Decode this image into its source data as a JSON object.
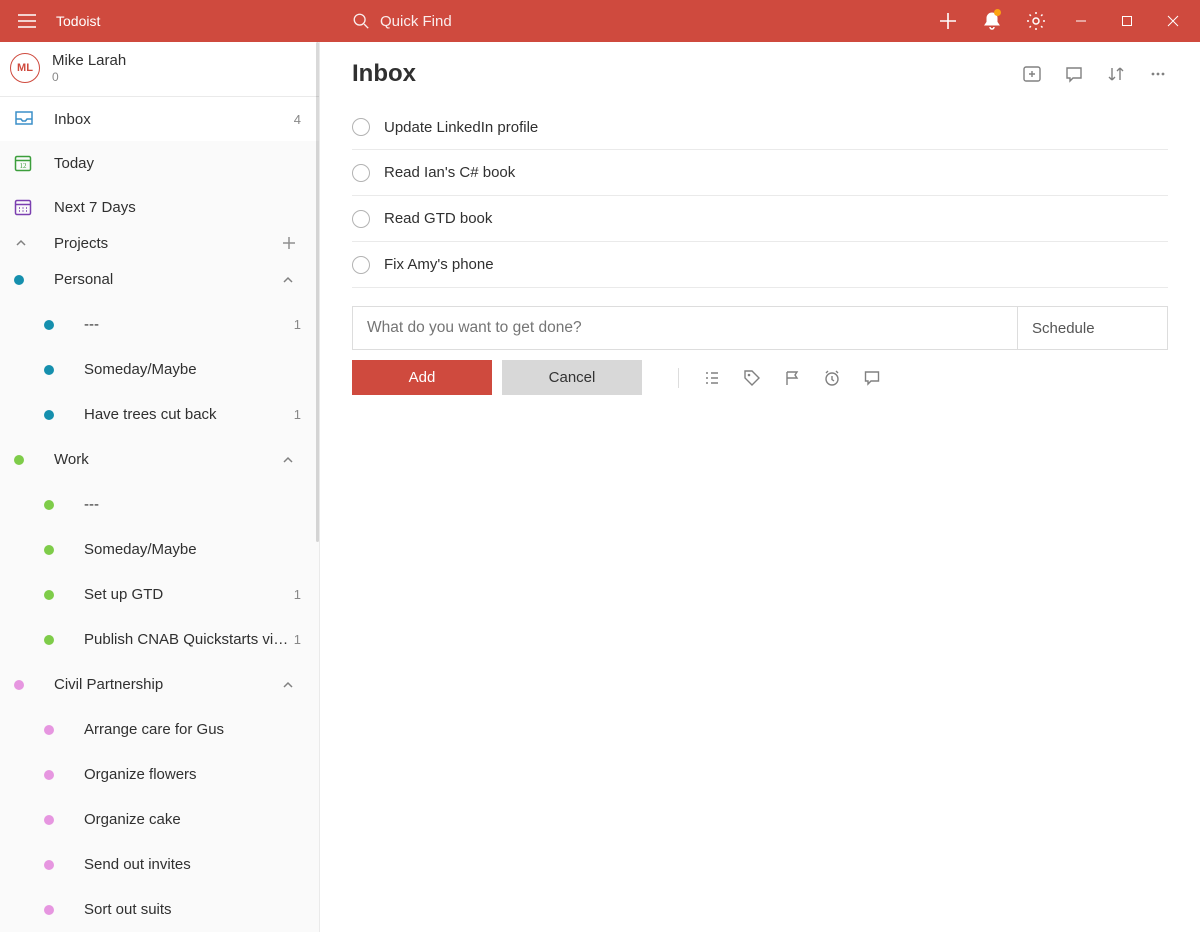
{
  "app": {
    "name": "Todoist"
  },
  "search": {
    "placeholder": "Quick Find"
  },
  "user": {
    "initials": "ML",
    "name": "Mike Larah",
    "karma": "0"
  },
  "nav": {
    "inbox": {
      "label": "Inbox",
      "count": "4"
    },
    "today": {
      "label": "Today"
    },
    "next7": {
      "label": "Next 7 Days"
    }
  },
  "sections": {
    "projects_label": "Projects"
  },
  "projects": [
    {
      "label": "Personal",
      "color": "teal",
      "depth": 0,
      "expandable": true
    },
    {
      "label": "---",
      "color": "teal",
      "depth": 1,
      "count": "1"
    },
    {
      "label": "Someday/Maybe",
      "color": "teal",
      "depth": 1
    },
    {
      "label": "Have trees cut back",
      "color": "teal",
      "depth": 1,
      "count": "1"
    },
    {
      "label": "Work",
      "color": "green",
      "depth": 0,
      "expandable": true
    },
    {
      "label": "---",
      "color": "green",
      "depth": 1
    },
    {
      "label": "Someday/Maybe",
      "color": "green",
      "depth": 1
    },
    {
      "label": "Set up GTD",
      "color": "green",
      "depth": 1,
      "count": "1"
    },
    {
      "label": "Publish CNAB Quickstarts vid...",
      "color": "green",
      "depth": 1,
      "count": "1"
    },
    {
      "label": "Civil Partnership",
      "color": "pink",
      "depth": 0,
      "expandable": true
    },
    {
      "label": "Arrange care for Gus",
      "color": "pink",
      "depth": 1
    },
    {
      "label": "Organize flowers",
      "color": "pink",
      "depth": 1
    },
    {
      "label": "Organize cake",
      "color": "pink",
      "depth": 1
    },
    {
      "label": "Send out invites",
      "color": "pink",
      "depth": 1
    },
    {
      "label": "Sort out suits",
      "color": "pink",
      "depth": 1
    }
  ],
  "main": {
    "title": "Inbox",
    "tasks": [
      {
        "title": "Update LinkedIn profile"
      },
      {
        "title": "Read Ian's C# book"
      },
      {
        "title": "Read GTD book"
      },
      {
        "title": "Fix Amy's phone"
      }
    ],
    "quickadd_placeholder": "What do you want to get done?",
    "schedule_label": "Schedule",
    "add_label": "Add",
    "cancel_label": "Cancel"
  }
}
